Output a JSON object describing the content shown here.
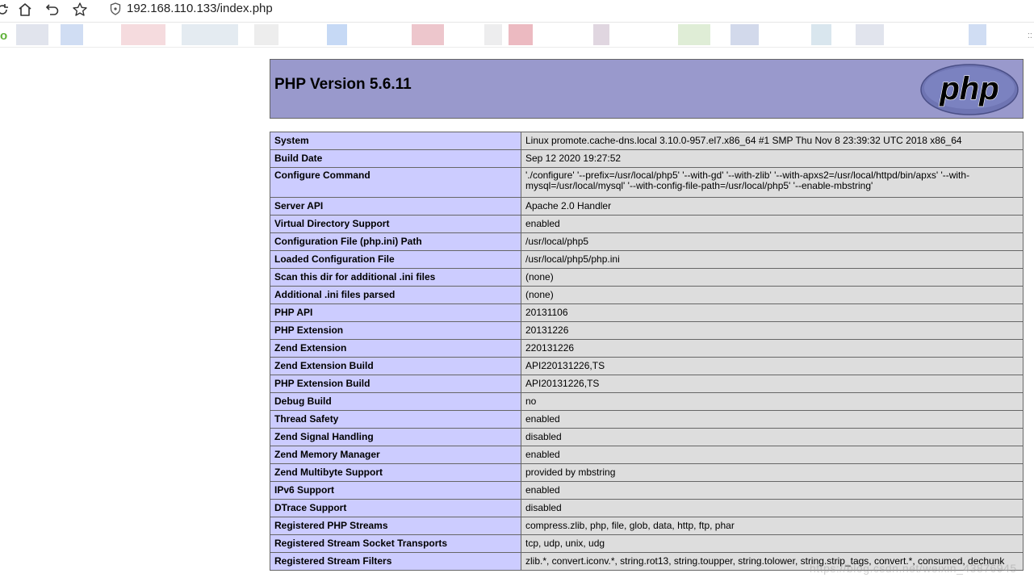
{
  "browser": {
    "url": "192.168.110.133/index.php",
    "bookmarks_leading": "o",
    "bookmarks_trailing": "::",
    "blur_colors": [
      "#d9dde8",
      "#c4d4f0",
      "#f2d2d6",
      "#dde6ee",
      "#e8e8e8",
      "#b8d0f2",
      "#e9b8bf",
      "#e8e8ea",
      "#e7a9b1",
      "#d8ccd8",
      "#d7e8cc",
      "#c7d0e6",
      "#cfe0ea"
    ]
  },
  "php": {
    "title": "PHP Version 5.6.11",
    "logo_text": "php",
    "rows": [
      {
        "label": "System",
        "value": "Linux promote.cache-dns.local 3.10.0-957.el7.x86_64 #1 SMP Thu Nov 8 23:39:32 UTC 2018 x86_64"
      },
      {
        "label": "Build Date",
        "value": "Sep 12 2020 19:27:52"
      },
      {
        "label": "Configure Command",
        "value": "'./configure' '--prefix=/usr/local/php5' '--with-gd' '--with-zlib' '--with-apxs2=/usr/local/httpd/bin/apxs' '--with-mysql=/usr/local/mysql' '--with-config-file-path=/usr/local/php5' '--enable-mbstring'"
      },
      {
        "label": "Server API",
        "value": "Apache 2.0 Handler"
      },
      {
        "label": "Virtual Directory Support",
        "value": "enabled"
      },
      {
        "label": "Configuration File (php.ini) Path",
        "value": "/usr/local/php5"
      },
      {
        "label": "Loaded Configuration File",
        "value": "/usr/local/php5/php.ini"
      },
      {
        "label": "Scan this dir for additional .ini files",
        "value": "(none)"
      },
      {
        "label": "Additional .ini files parsed",
        "value": "(none)"
      },
      {
        "label": "PHP API",
        "value": "20131106"
      },
      {
        "label": "PHP Extension",
        "value": "20131226"
      },
      {
        "label": "Zend Extension",
        "value": "220131226"
      },
      {
        "label": "Zend Extension Build",
        "value": "API220131226,TS"
      },
      {
        "label": "PHP Extension Build",
        "value": "API20131226,TS"
      },
      {
        "label": "Debug Build",
        "value": "no"
      },
      {
        "label": "Thread Safety",
        "value": "enabled"
      },
      {
        "label": "Zend Signal Handling",
        "value": "disabled"
      },
      {
        "label": "Zend Memory Manager",
        "value": "enabled"
      },
      {
        "label": "Zend Multibyte Support",
        "value": "provided by mbstring"
      },
      {
        "label": "IPv6 Support",
        "value": "enabled"
      },
      {
        "label": "DTrace Support",
        "value": "disabled"
      },
      {
        "label": "Registered PHP Streams",
        "value": "compress.zlib, php, file, glob, data, http, ftp, phar"
      },
      {
        "label": "Registered Stream Socket Transports",
        "value": "tcp, udp, unix, udg"
      },
      {
        "label": "Registered Stream Filters",
        "value": "zlib.*, convert.iconv.*, string.rot13, string.toupper, string.tolower, string.strip_tags, convert.*, consumed, dechunk"
      }
    ]
  },
  "watermark": "https://blog.csdn.net/weixin_43876945"
}
